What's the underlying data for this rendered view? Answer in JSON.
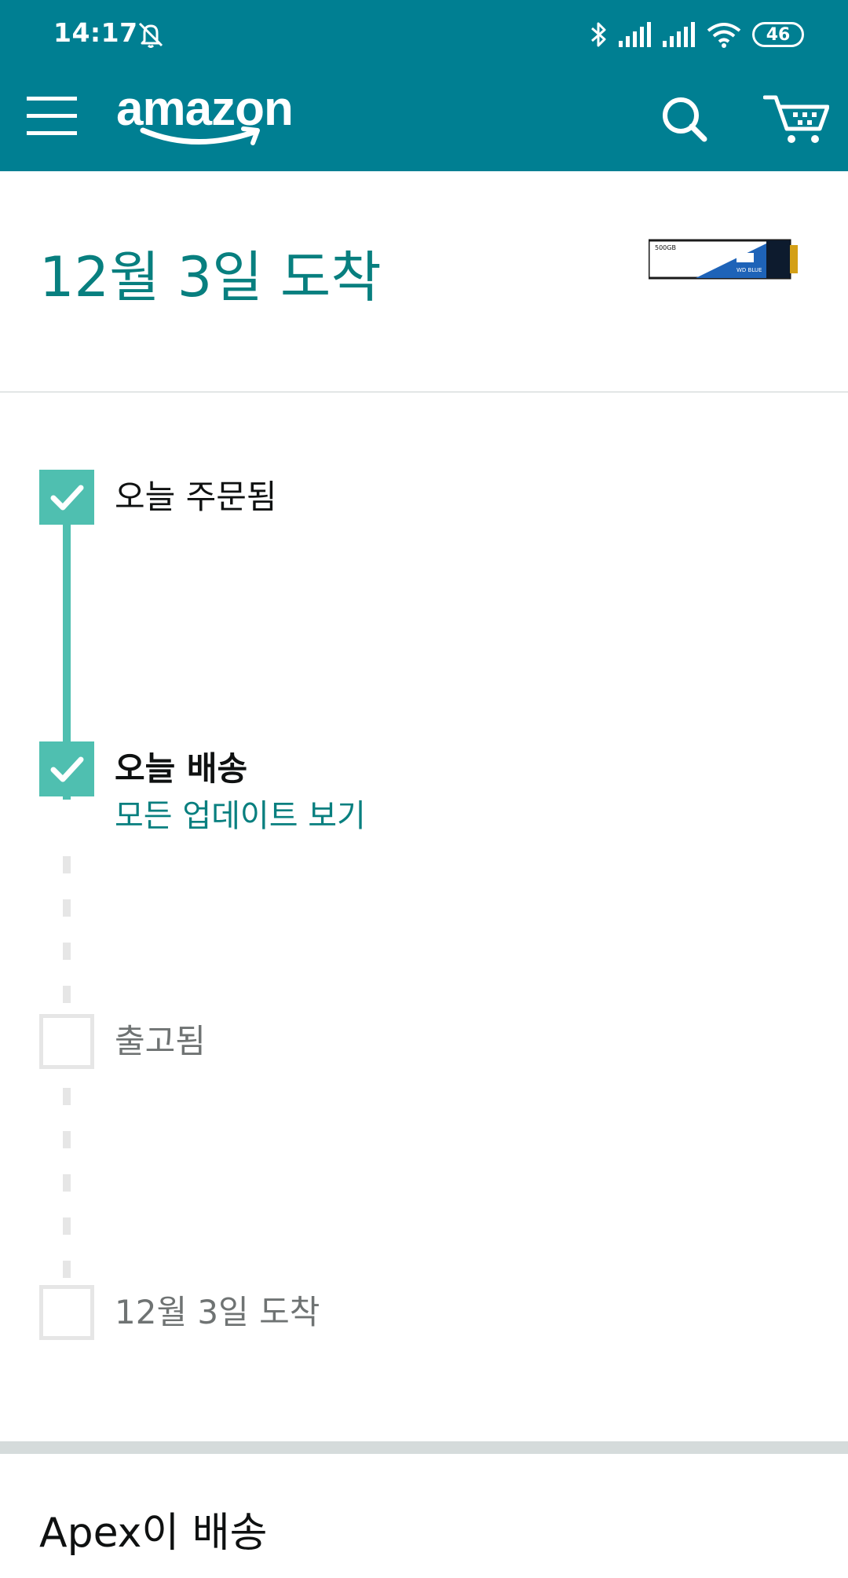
{
  "status_bar": {
    "time": "14:17",
    "battery": "46",
    "icons": [
      "bell-off-icon",
      "bluetooth-icon",
      "signal-icon",
      "signal-icon",
      "wifi-icon",
      "battery-icon"
    ]
  },
  "header": {
    "brand": "amazon",
    "icons": [
      "menu-icon",
      "search-icon",
      "cart-icon"
    ],
    "color": "#007f92"
  },
  "arrival": {
    "title": "12월 3일 도착",
    "thumbnail_text": "500GB",
    "thumbnail_brand": "WD BLUE",
    "color": "#087f7f"
  },
  "timeline": {
    "steps": [
      {
        "label": "오늘 주문됨",
        "done": true
      },
      {
        "label": "오늘 배송",
        "done": true,
        "link": "모든 업데이트 보기"
      },
      {
        "label": "출고됨",
        "done": false
      },
      {
        "label": "12월 3일 도착",
        "done": false
      }
    ],
    "done_color": "#4fbfb0"
  },
  "carrier": {
    "label": "Apex이 배송"
  }
}
